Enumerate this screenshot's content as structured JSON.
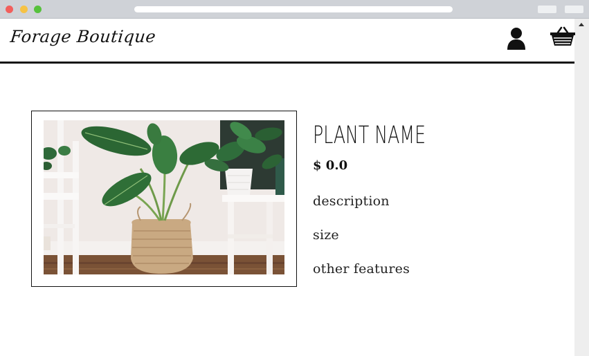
{
  "site": {
    "logo_text": "Forage Boutique"
  },
  "header": {
    "account_icon": "user-icon",
    "cart_icon": "basket-icon"
  },
  "product": {
    "name": "PLANT NAME",
    "price": "$ 0.0",
    "description": "description",
    "size": "size",
    "other_features": "other features",
    "image": "potted-plant-photo"
  },
  "colors": {
    "text": "#111111",
    "border": "#111111",
    "background": "#ffffff"
  }
}
